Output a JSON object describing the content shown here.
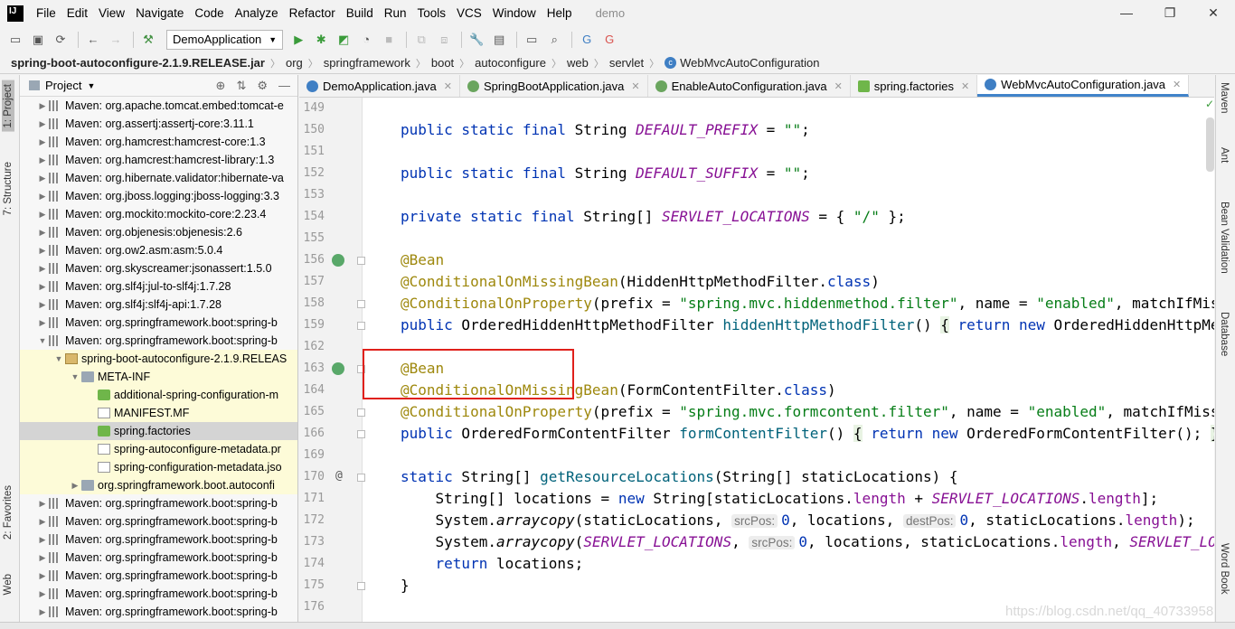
{
  "menu": {
    "items": [
      "File",
      "Edit",
      "View",
      "Navigate",
      "Code",
      "Analyze",
      "Refactor",
      "Build",
      "Run",
      "Tools",
      "VCS",
      "Window",
      "Help"
    ],
    "window_title": "demo"
  },
  "toolbar": {
    "run_config": "DemoApplication"
  },
  "breadcrumb": [
    "spring-boot-autoconfigure-2.1.9.RELEASE.jar",
    "org",
    "springframework",
    "boot",
    "autoconfigure",
    "web",
    "servlet",
    "WebMvcAutoConfiguration"
  ],
  "left_tabs": {
    "project": "1: Project",
    "structure": "7: Structure",
    "favorites": "2: Favorites",
    "web": "Web"
  },
  "project_panel": {
    "title": "Project",
    "tree": [
      {
        "label": "Maven: org.apache.tomcat.embed:tomcat-e",
        "indent": 1,
        "arrow": "▶",
        "icon": "lib"
      },
      {
        "label": "Maven: org.assertj:assertj-core:3.11.1",
        "indent": 1,
        "arrow": "▶",
        "icon": "lib"
      },
      {
        "label": "Maven: org.hamcrest:hamcrest-core:1.3",
        "indent": 1,
        "arrow": "▶",
        "icon": "lib"
      },
      {
        "label": "Maven: org.hamcrest:hamcrest-library:1.3",
        "indent": 1,
        "arrow": "▶",
        "icon": "lib"
      },
      {
        "label": "Maven: org.hibernate.validator:hibernate-va",
        "indent": 1,
        "arrow": "▶",
        "icon": "lib"
      },
      {
        "label": "Maven: org.jboss.logging:jboss-logging:3.3",
        "indent": 1,
        "arrow": "▶",
        "icon": "lib"
      },
      {
        "label": "Maven: org.mockito:mockito-core:2.23.4",
        "indent": 1,
        "arrow": "▶",
        "icon": "lib"
      },
      {
        "label": "Maven: org.objenesis:objenesis:2.6",
        "indent": 1,
        "arrow": "▶",
        "icon": "lib"
      },
      {
        "label": "Maven: org.ow2.asm:asm:5.0.4",
        "indent": 1,
        "arrow": "▶",
        "icon": "lib"
      },
      {
        "label": "Maven: org.skyscreamer:jsonassert:1.5.0",
        "indent": 1,
        "arrow": "▶",
        "icon": "lib"
      },
      {
        "label": "Maven: org.slf4j:jul-to-slf4j:1.7.28",
        "indent": 1,
        "arrow": "▶",
        "icon": "lib"
      },
      {
        "label": "Maven: org.slf4j:slf4j-api:1.7.28",
        "indent": 1,
        "arrow": "▶",
        "icon": "lib"
      },
      {
        "label": "Maven: org.springframework.boot:spring-b",
        "indent": 1,
        "arrow": "▶",
        "icon": "lib"
      },
      {
        "label": "Maven: org.springframework.boot:spring-b",
        "indent": 1,
        "arrow": "▼",
        "icon": "lib"
      },
      {
        "label": "spring-boot-autoconfigure-2.1.9.RELEAS",
        "indent": 2,
        "arrow": "▼",
        "icon": "jar",
        "highlight": true
      },
      {
        "label": "META-INF",
        "indent": 3,
        "arrow": "▼",
        "icon": "folder",
        "highlight": true
      },
      {
        "label": "additional-spring-configuration-m",
        "indent": 4,
        "arrow": "",
        "icon": "spring",
        "highlight": true
      },
      {
        "label": "MANIFEST.MF",
        "indent": 4,
        "arrow": "",
        "icon": "mf",
        "highlight": true
      },
      {
        "label": "spring.factories",
        "indent": 4,
        "arrow": "",
        "icon": "spring",
        "selected": true
      },
      {
        "label": "spring-autoconfigure-metadata.pr",
        "indent": 4,
        "arrow": "",
        "icon": "file",
        "highlight": true
      },
      {
        "label": "spring-configuration-metadata.jso",
        "indent": 4,
        "arrow": "",
        "icon": "file",
        "highlight": true
      },
      {
        "label": "org.springframework.boot.autoconfi",
        "indent": 3,
        "arrow": "▶",
        "icon": "folder",
        "highlight": true
      },
      {
        "label": "Maven: org.springframework.boot:spring-b",
        "indent": 1,
        "arrow": "▶",
        "icon": "lib"
      },
      {
        "label": "Maven: org.springframework.boot:spring-b",
        "indent": 1,
        "arrow": "▶",
        "icon": "lib"
      },
      {
        "label": "Maven: org.springframework.boot:spring-b",
        "indent": 1,
        "arrow": "▶",
        "icon": "lib"
      },
      {
        "label": "Maven: org.springframework.boot:spring-b",
        "indent": 1,
        "arrow": "▶",
        "icon": "lib"
      },
      {
        "label": "Maven: org.springframework.boot:spring-b",
        "indent": 1,
        "arrow": "▶",
        "icon": "lib"
      },
      {
        "label": "Maven: org.springframework.boot:spring-b",
        "indent": 1,
        "arrow": "▶",
        "icon": "lib"
      },
      {
        "label": "Maven: org.springframework.boot:spring-b",
        "indent": 1,
        "arrow": "▶",
        "icon": "lib"
      }
    ]
  },
  "editor_tabs": [
    {
      "label": "DemoApplication.java",
      "icon": "c",
      "active": false
    },
    {
      "label": "SpringBootApplication.java",
      "icon": "a",
      "active": false
    },
    {
      "label": "EnableAutoConfiguration.java",
      "icon": "a",
      "active": false
    },
    {
      "label": "spring.factories",
      "icon": "s",
      "active": false
    },
    {
      "label": "WebMvcAutoConfiguration.java",
      "icon": "c",
      "active": true
    }
  ],
  "editor": {
    "line_numbers": [
      "149",
      "150",
      "151",
      "152",
      "153",
      "154",
      "155",
      "156",
      "157",
      "158",
      "159",
      "162",
      "163",
      "164",
      "165",
      "166",
      "169",
      "170",
      "171",
      "172",
      "173",
      "174",
      "175",
      "176"
    ],
    "code_lines": [
      {
        "n": "149",
        "html": ""
      },
      {
        "n": "150",
        "html": "<span class='kw'>public static final</span> String <span class='cst'>DEFAULT_PREFIX</span> = <span class='str'>\"\"</span>;"
      },
      {
        "n": "151",
        "html": ""
      },
      {
        "n": "152",
        "html": "<span class='kw'>public static final</span> String <span class='cst'>DEFAULT_SUFFIX</span> = <span class='str'>\"\"</span>;"
      },
      {
        "n": "153",
        "html": ""
      },
      {
        "n": "154",
        "html": "<span class='kw'>private static final</span> String[] <span class='cst'>SERVLET_LOCATIONS</span> = { <span class='str'>\"/\"</span> };"
      },
      {
        "n": "155",
        "html": ""
      },
      {
        "n": "156",
        "html": "<span class='ann'>@Bean</span>"
      },
      {
        "n": "157",
        "html": "<span class='ann'>@ConditionalOnMissingBean</span>(HiddenHttpMethodFilter.<span class='kw'>class</span>)"
      },
      {
        "n": "158",
        "html": "<span class='ann'>@ConditionalOnProperty</span>(prefix = <span class='str'>\"spring.mvc.hiddenmethod.filter\"</span>, name = <span class='str'>\"enabled\"</span>, matchIfMissing = "
      },
      {
        "n": "159",
        "html": "<span class='kw'>public</span> OrderedHiddenHttpMethodFilter <span class='mth'>hiddenHttpMethodFilter</span>() <span class='brace-hl'>{</span> <span class='kw'>return new</span> OrderedHiddenHttpMethodFi"
      },
      {
        "n": "162",
        "html": ""
      },
      {
        "n": "163",
        "html": "<span class='ann'>@Bean</span>"
      },
      {
        "n": "164",
        "html": "<span class='ann'>@ConditionalOnMissingBean</span>(FormContentFilter.<span class='kw'>class</span>)"
      },
      {
        "n": "165",
        "html": "<span class='ann'>@ConditionalOnProperty</span>(prefix = <span class='str'>\"spring.mvc.formcontent.filter\"</span>, name = <span class='str'>\"enabled\"</span>, matchIfMissing = "
      },
      {
        "n": "166",
        "html": "<span class='kw'>public</span> OrderedFormContentFilter <span class='mth'>formContentFilter</span>() <span class='brace-hl'>{</span> <span class='kw'>return new</span> OrderedFormContentFilter(); <span class='brace-hl'>}</span>"
      },
      {
        "n": "169",
        "html": ""
      },
      {
        "n": "170",
        "html": "<span class='kw'>static</span> String[] <span class='mth'>getResourceLocations</span>(String[] staticLocations) {"
      },
      {
        "n": "171",
        "html": "    String[] locations = <span class='kw'>new</span> String[staticLocations.<span class='cst' style='font-style:normal'>length</span> + <span class='cst'>SERVLET_LOCATIONS</span>.<span class='cst' style='font-style:normal'>length</span>];"
      },
      {
        "n": "172",
        "html": "    System.<span class='itl'>arraycopy</span>(staticLocations, <span class='hint'>srcPos:</span><span class='kw'>0</span>, locations, <span class='hint'>destPos:</span><span class='kw'>0</span>, staticLocations.<span class='cst' style='font-style:normal'>length</span>);"
      },
      {
        "n": "173",
        "html": "    System.<span class='itl'>arraycopy</span>(<span class='cst'>SERVLET_LOCATIONS</span>, <span class='hint'>srcPos:</span><span class='kw'>0</span>, locations, staticLocations.<span class='cst' style='font-style:normal'>length</span>, <span class='cst'>SERVLET_LOCATION</span>"
      },
      {
        "n": "174",
        "html": "    <span class='kw'>return</span> locations;"
      },
      {
        "n": "175",
        "html": "}"
      },
      {
        "n": "176",
        "html": ""
      }
    ]
  },
  "right_tabs": {
    "maven": "Maven",
    "ant": "Ant",
    "bean_validation": "Bean Validation",
    "database": "Database",
    "word_book": "Word Book"
  },
  "watermark": "https://blog.csdn.net/qq_40733958",
  "colors": {
    "keyword": "#0033b3",
    "constant": "#871094",
    "string": "#067d17",
    "annotation": "#9e880d",
    "method": "#00627a",
    "highlight_box": "#e0201b",
    "active_tab_underline": "#4083c9"
  }
}
